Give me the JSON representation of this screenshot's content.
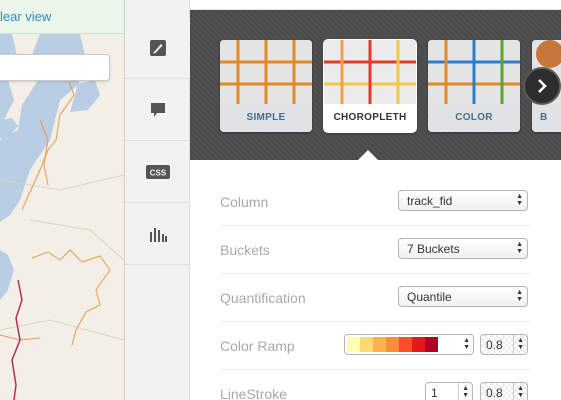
{
  "map": {
    "clear_view_label": "lear view",
    "search_placeholder": ""
  },
  "rail": {
    "items": [
      {
        "name": "wizard",
        "icon": "paintbrush-icon",
        "active": true
      },
      {
        "name": "infowindow",
        "icon": "speech-bubble-icon",
        "active": false
      },
      {
        "name": "css",
        "icon": "css-icon",
        "label": "CSS",
        "active": false
      },
      {
        "name": "legends",
        "icon": "bar-chart-icon",
        "active": false
      }
    ]
  },
  "wizard": {
    "cards": [
      {
        "label": "SIMPLE",
        "selected": false
      },
      {
        "label": "CHOROPLETH",
        "selected": true
      },
      {
        "label": "COLOR",
        "selected": false
      },
      {
        "label": "B",
        "selected": false
      }
    ],
    "next_icon": "chevron-right-icon"
  },
  "form": {
    "column": {
      "label": "Column",
      "value": "track_fid"
    },
    "buckets": {
      "label": "Buckets",
      "value": "7 Buckets"
    },
    "quantification": {
      "label": "Quantification",
      "value": "Quantile"
    },
    "color_ramp": {
      "label": "Color Ramp",
      "colors": [
        "#ffffb2",
        "#fed976",
        "#feb24c",
        "#fd8d3c",
        "#fc4e2a",
        "#e31a1c",
        "#b10026"
      ],
      "opacity": "0.8"
    },
    "line_stroke": {
      "label": "LineStroke",
      "width": "1",
      "opacity": "0.8"
    }
  },
  "colors": {
    "strip_bg": "#4a4a4a",
    "label_link": "#4a6d8c",
    "map_bg": "#f4efe6",
    "water": "#b9cde4",
    "road_orange": "#e69a4a",
    "border_red": "#b0305a"
  }
}
